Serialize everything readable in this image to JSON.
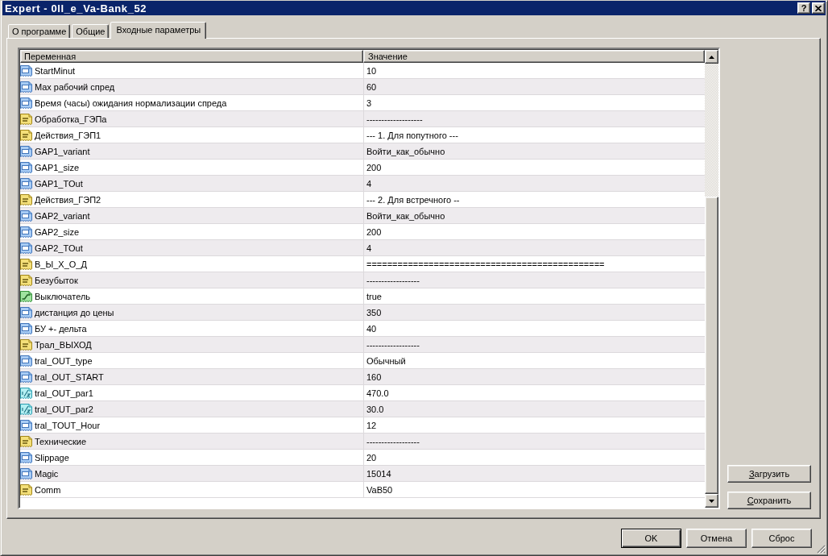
{
  "window": {
    "title": "Expert - 0ll_e_Va-Bank_52",
    "help_button": "?"
  },
  "tabs": [
    {
      "label": "О программе",
      "selected": false
    },
    {
      "label": "Общие",
      "selected": false
    },
    {
      "label": "Входные параметры",
      "selected": true
    }
  ],
  "table": {
    "columns": [
      "Переменная",
      "Значение"
    ],
    "rows": [
      {
        "kind": "int",
        "name": "StartMinut",
        "value": "10"
      },
      {
        "kind": "int",
        "name": "Max рабочий спред",
        "value": "60"
      },
      {
        "kind": "int",
        "name": "Время (часы) ожидания нормализации спреда",
        "value": "3"
      },
      {
        "kind": "string",
        "name": "Обработка_ГЭПа",
        "value": "-------------------"
      },
      {
        "kind": "string",
        "name": "Действия_ГЭП1",
        "value": "--- 1. Для попутного ---"
      },
      {
        "kind": "int",
        "name": "GAP1_variant",
        "value": "Войти_как_обычно"
      },
      {
        "kind": "int",
        "name": "GAP1_size",
        "value": "200"
      },
      {
        "kind": "int",
        "name": "GAP1_TOut",
        "value": "4"
      },
      {
        "kind": "string",
        "name": "Действия_ГЭП2",
        "value": "--- 2. Для встречного --"
      },
      {
        "kind": "int",
        "name": "GAP2_variant",
        "value": "Войти_как_обычно"
      },
      {
        "kind": "int",
        "name": "GAP2_size",
        "value": "200"
      },
      {
        "kind": "int",
        "name": "GAP2_TOut",
        "value": "4"
      },
      {
        "kind": "string",
        "name": "В_Ы_Х_О_Д",
        "value": "=============================================="
      },
      {
        "kind": "string",
        "name": "Безубыток",
        "value": "------------------"
      },
      {
        "kind": "bool",
        "name": "Выключатель",
        "value": "true"
      },
      {
        "kind": "int",
        "name": "дистанция до цены",
        "value": "350"
      },
      {
        "kind": "int",
        "name": "БУ +- дельта",
        "value": "40"
      },
      {
        "kind": "string",
        "name": "Трал_ВЫХОД",
        "value": "------------------"
      },
      {
        "kind": "int",
        "name": "tral_OUT_type",
        "value": "Обычный"
      },
      {
        "kind": "int",
        "name": "tral_OUT_START",
        "value": "160"
      },
      {
        "kind": "double",
        "name": "tral_OUT_par1",
        "value": "470.0"
      },
      {
        "kind": "double",
        "name": "tral_OUT_par2",
        "value": "30.0"
      },
      {
        "kind": "int",
        "name": "tral_TOUT_Hour",
        "value": "12"
      },
      {
        "kind": "string",
        "name": "Технические",
        "value": "------------------"
      },
      {
        "kind": "int",
        "name": "Slippage",
        "value": "20"
      },
      {
        "kind": "int",
        "name": "Magic",
        "value": "15014"
      },
      {
        "kind": "string",
        "name": "Comm",
        "value": "VaB50"
      }
    ]
  },
  "side_buttons": [
    "Загрузить",
    "Сохранить"
  ],
  "footer_buttons": [
    {
      "label": "OK",
      "default": true
    },
    {
      "label": "Отмена",
      "default": false
    },
    {
      "label": "Сброс",
      "default": false
    }
  ]
}
